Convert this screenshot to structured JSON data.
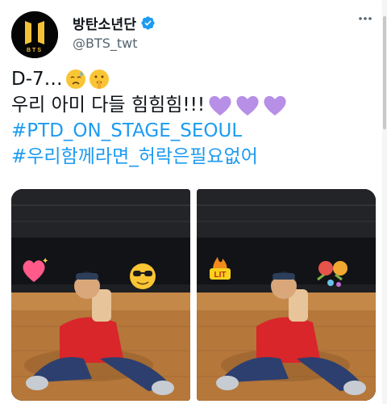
{
  "author": {
    "display_name": "방탄소년단",
    "handle": "@BTS_twt",
    "logo_text": "BTS",
    "verified": true
  },
  "tweet": {
    "line1": "D-7…",
    "line2": "우리 아미 다들 힘힘힘!!!",
    "hashtag1": "#PTD_ON_STAGE_SEOUL",
    "hashtag2": "#우리함께라면_허락은필요없어"
  },
  "icons": {
    "line1_emojis": [
      "sad-sweat-emoji",
      "shushing-face-emoji"
    ],
    "line2_emojis": [
      "purple-heart-emoji",
      "purple-heart-emoji",
      "purple-heart-emoji"
    ],
    "left_photo_stickers": [
      "sparkling-heart-sticker",
      "sunglasses-face-sticker"
    ],
    "right_photo_stickers": [
      "lit-fire-sticker",
      "noise-maker-sticker"
    ]
  },
  "stickers": {
    "lit_label": "LIT"
  },
  "colors": {
    "hashtag": "#1d9bf0",
    "verified": "#1d9bf0",
    "heart": "#b78fe6",
    "logo_gold": "#f2c23a",
    "sweater": "#d8262b"
  }
}
